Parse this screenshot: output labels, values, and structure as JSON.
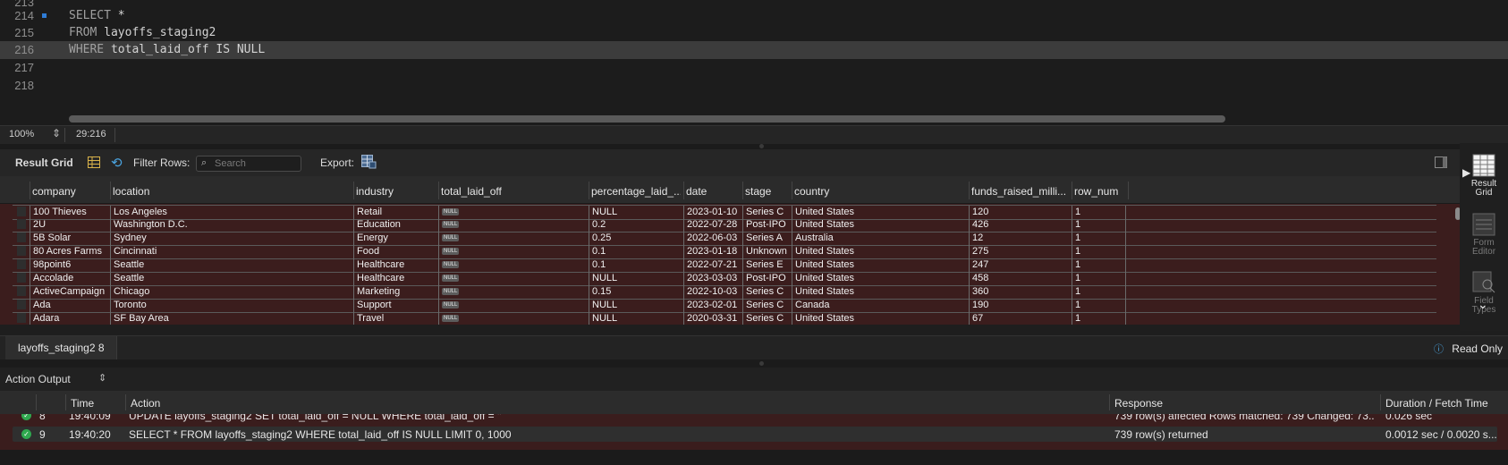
{
  "editor": {
    "lines": [
      {
        "num": "214",
        "keyword": "SELECT",
        "rest": " *",
        "marker": true,
        "highlight": false
      },
      {
        "num": "215",
        "keyword": "FROM",
        "rest": " layoffs_staging2",
        "marker": false,
        "highlight": false
      },
      {
        "num": "216",
        "keyword": "WHERE",
        "rest": " total_laid_off IS NULL",
        "marker": false,
        "highlight": true
      },
      {
        "num": "217",
        "keyword": "",
        "rest": "",
        "marker": false,
        "highlight": false
      },
      {
        "num": "218",
        "keyword": "",
        "rest": "",
        "marker": false,
        "highlight": false
      }
    ],
    "zoom": "100%",
    "cursor": "29:216"
  },
  "result_toolbar": {
    "title": "Result Grid",
    "filter_label": "Filter Rows:",
    "search_placeholder": "Search",
    "export_label": "Export:"
  },
  "grid": {
    "columns": [
      "company",
      "location",
      "industry",
      "total_laid_off",
      "percentage_laid_...",
      "date",
      "stage",
      "country",
      "funds_raised_milli...",
      "row_num"
    ],
    "rows": [
      [
        "100 Thieves",
        "Los Angeles",
        "Retail",
        "NULL",
        "NULL",
        "2023-01-10",
        "Series C",
        "United States",
        "120",
        "1"
      ],
      [
        "2U",
        "Washington D.C.",
        "Education",
        "NULL",
        "0.2",
        "2022-07-28",
        "Post-IPO",
        "United States",
        "426",
        "1"
      ],
      [
        "5B Solar",
        "Sydney",
        "Energy",
        "NULL",
        "0.25",
        "2022-06-03",
        "Series A",
        "Australia",
        "12",
        "1"
      ],
      [
        "80 Acres Farms",
        "Cincinnati",
        "Food",
        "NULL",
        "0.1",
        "2023-01-18",
        "Unknown",
        "United States",
        "275",
        "1"
      ],
      [
        "98point6",
        "Seattle",
        "Healthcare",
        "NULL",
        "0.1",
        "2022-07-21",
        "Series E",
        "United States",
        "247",
        "1"
      ],
      [
        "Accolade",
        "Seattle",
        "Healthcare",
        "NULL",
        "NULL",
        "2023-03-03",
        "Post-IPO",
        "United States",
        "458",
        "1"
      ],
      [
        "ActiveCampaign",
        "Chicago",
        "Marketing",
        "NULL",
        "0.15",
        "2022-10-03",
        "Series C",
        "United States",
        "360",
        "1"
      ],
      [
        "Ada",
        "Toronto",
        "Support",
        "NULL",
        "NULL",
        "2023-02-01",
        "Series C",
        "Canada",
        "190",
        "1"
      ],
      [
        "Adara",
        "SF Bay Area",
        "Travel",
        "NULL",
        "NULL",
        "2020-03-31",
        "Series C",
        "United States",
        "67",
        "1"
      ]
    ]
  },
  "sidebar": {
    "result_grid": [
      "Result",
      "Grid"
    ],
    "form_editor": [
      "Form",
      "Editor"
    ],
    "field_types": [
      "Field",
      "Types"
    ]
  },
  "tabs": {
    "result_tab": "layoffs_staging2 8",
    "read_only": "Read Only"
  },
  "output": {
    "title": "Action Output",
    "columns": [
      "Time",
      "Action",
      "Response",
      "Duration / Fetch Time"
    ],
    "rows": [
      {
        "num": "8",
        "time": "19:40:09",
        "action": "UPDATE layoffs_staging2 SET total_laid_off = NULL WHERE total_laid_off = ''",
        "response": "739 row(s) affected Rows matched: 739  Changed: 73...",
        "duration": "0.026 sec"
      },
      {
        "num": "9",
        "time": "19:40:20",
        "action": "SELECT * FROM layoffs_staging2 WHERE total_laid_off IS NULL LIMIT 0, 1000",
        "response": "739 row(s) returned",
        "duration": "0.0012 sec / 0.0020 s..."
      }
    ]
  }
}
